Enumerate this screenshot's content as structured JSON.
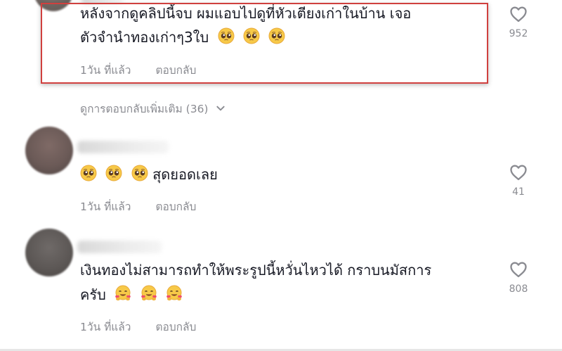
{
  "comments": [
    {
      "text_line1": "หลังจากดูคลิปนี้จบ ผมแอบไปดูที่หัวเตียงเก่าในบ้าน เจอ",
      "text_line2": "ตัวจำนำทองเก่าๆ3ใบ",
      "emoji": "pleading-face",
      "time": "1วัน ที่แล้ว",
      "reply_label": "ตอบกลับ",
      "likes": "952"
    },
    {
      "text_line1": "สุดยอดเลย",
      "emoji": "pleading-face",
      "time": "1วัน ที่แล้ว",
      "reply_label": "ตอบกลับ",
      "likes": "41"
    },
    {
      "text_line1": "เงินทองไม่สามารถทำให้พระรูปนี้หวั่นไหวได้ กราบนมัสการ",
      "text_line2": "ครับ",
      "emoji": "hugging-face",
      "time": "1วัน ที่แล้ว",
      "reply_label": "ตอบกลับ",
      "likes": "808"
    }
  ],
  "more_replies_label": "ดูการตอบกลับเพิ่มเติม (36)",
  "colors": {
    "highlight_border": "#d0403e",
    "secondary_text": "#8a8b91",
    "primary_text": "#161823"
  }
}
